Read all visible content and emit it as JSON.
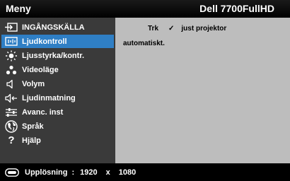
{
  "header": {
    "title": "Meny",
    "model": "Dell 7700FullHD"
  },
  "menu": [
    {
      "label": "INGÅNGSKÄLLA",
      "icon": "input-source-icon",
      "selected": false
    },
    {
      "label": "Ljudkontroll",
      "icon": "audio-control-icon",
      "selected": true
    },
    {
      "label": "Ljusstyrka/kontr.",
      "icon": "brightness-icon",
      "selected": false
    },
    {
      "label": "Videoläge",
      "icon": "video-mode-icon",
      "selected": false
    },
    {
      "label": "Volym",
      "icon": "volume-icon",
      "selected": false
    },
    {
      "label": "Ljudinmatning",
      "icon": "audio-input-icon",
      "selected": false
    },
    {
      "label": "Avanc. inst",
      "icon": "advanced-settings-icon",
      "selected": false
    },
    {
      "label": "Språk",
      "icon": "language-icon",
      "selected": false
    },
    {
      "label": "Hjälp",
      "icon": "help-icon",
      "selected": false
    }
  ],
  "content": {
    "row1_label": "Trk",
    "row1_check": "✓",
    "row1_value": "just projektor",
    "row2_value": "automatiskt."
  },
  "footer": {
    "label": "Upplösning",
    "separator": ":",
    "width": "1920",
    "x": "x",
    "height": "1080",
    "icon": "resolution-icon"
  },
  "colors": {
    "selected": "#2f7fc5",
    "sidebar": "#3a3a3a",
    "content": "#bdbdbd",
    "header": "#000000"
  }
}
